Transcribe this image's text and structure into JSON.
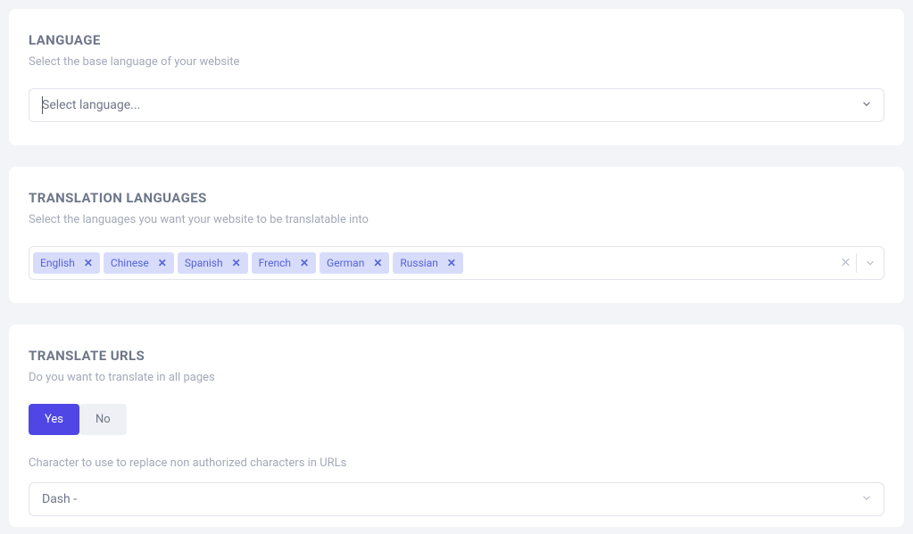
{
  "language": {
    "title": "LANGUAGE",
    "subtitle": "Select the base language of your website",
    "placeholder": "Select language..."
  },
  "translation": {
    "title": "TRANSLATION LANGUAGES",
    "subtitle": "Select the languages you want your website to be translatable into",
    "tags": [
      "English",
      "Chinese",
      "Spanish",
      "French",
      "German",
      "Russian"
    ]
  },
  "urls": {
    "title": "TRANSLATE URLS",
    "subtitle": "Do you want to translate in all pages",
    "yes": "Yes",
    "no": "No",
    "char_label": "Character to use to replace non authorized characters in URLs",
    "char_value": "Dash -"
  }
}
